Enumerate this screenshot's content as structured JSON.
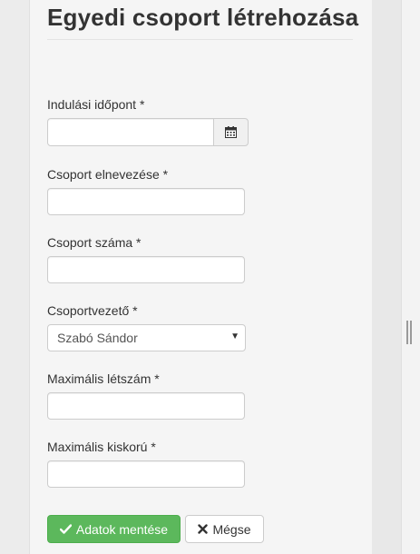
{
  "page": {
    "title": "Egyedi csoport létrehozása"
  },
  "form": {
    "start_date": {
      "label": "Indulási időpont *",
      "value": "",
      "addon_icon": "calendar-icon"
    },
    "group_name": {
      "label": "Csoport elnevezése *",
      "value": ""
    },
    "group_number": {
      "label": "Csoport száma *",
      "value": ""
    },
    "group_leader": {
      "label": "Csoportvezető *",
      "selected": "Szabó Sándor"
    },
    "max_headcount": {
      "label": "Maximális létszám *",
      "value": ""
    },
    "max_minor_age": {
      "label": "Maximális kiskorú *",
      "value": ""
    }
  },
  "actions": {
    "save_label": "Adatok mentése",
    "save_icon": "checkmark-icon",
    "cancel_label": "Mégse",
    "cancel_icon": "close-icon"
  },
  "colors": {
    "save_button_bg": "#5cb85c",
    "panel_bg": "#f5f5f5",
    "page_bg": "#e8e8e8"
  }
}
